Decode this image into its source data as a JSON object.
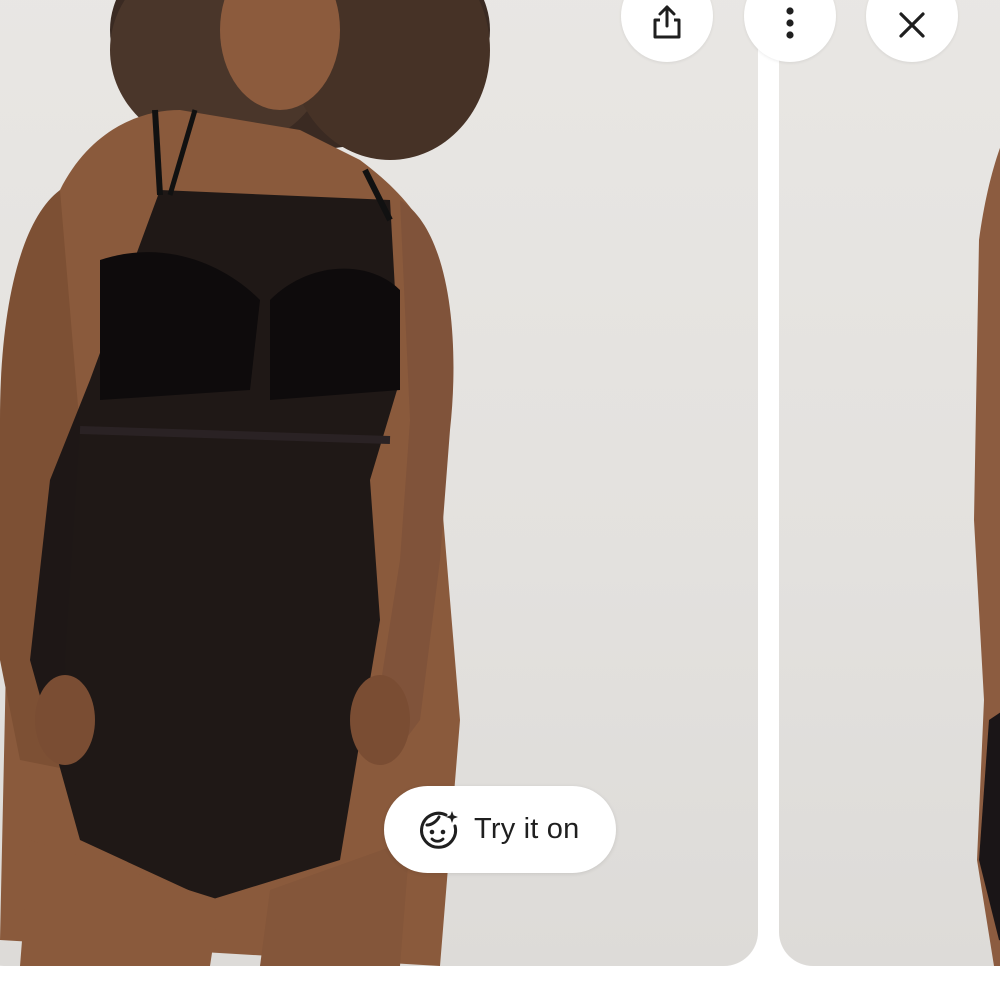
{
  "actions": {
    "share_icon": "share-icon",
    "more_icon": "more-vertical-icon",
    "close_icon": "close-icon"
  },
  "try_on": {
    "label": "Try it on",
    "icon": "face-sparkle-icon"
  },
  "colors": {
    "background": "#ffffff",
    "card_background": "#e6e4e1",
    "button_background": "#ffffff",
    "icon_color": "#1f1f1f"
  }
}
